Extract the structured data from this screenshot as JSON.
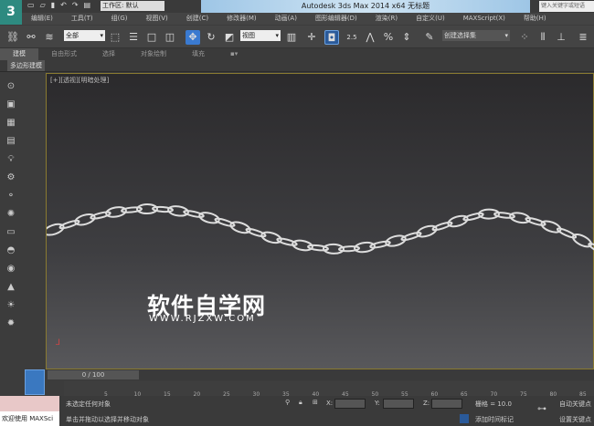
{
  "title_bar": {
    "logo": "3",
    "workspace": "工作区: 默认",
    "title": "Autodesk 3ds Max  2014 x64    无标题",
    "search_placeholder": "键入关键字或短语"
  },
  "menu": [
    "编辑(E)",
    "工具(T)",
    "组(G)",
    "视图(V)",
    "创建(C)",
    "修改器(M)",
    "动画(A)",
    "图形编辑器(D)",
    "渲染(R)",
    "自定义(U)",
    "MAXScript(X)",
    "帮助(H)"
  ],
  "toolbar": {
    "filter": "全部",
    "coord_system": "视图",
    "snap_angle": "2.5",
    "selection_set": "创建选择集"
  },
  "ribbon": {
    "tabs": [
      "建模",
      "自由形式",
      "选择",
      "对象绘制",
      "填充"
    ],
    "active": "建模",
    "subtab": "多边形建模"
  },
  "viewport": {
    "label": "[+][透视][明暗处理]"
  },
  "watermark": {
    "line1": "软件自学网",
    "line2": "WWW.RJZXW.COM"
  },
  "timeline": {
    "slider": "0 / 100",
    "ticks": [
      "5",
      "10",
      "15",
      "20",
      "25",
      "30",
      "35",
      "40",
      "45",
      "50",
      "55",
      "60",
      "65",
      "70",
      "75",
      "80",
      "85"
    ]
  },
  "status": {
    "welcome": "欢迎使用 MAXSci",
    "selection": "未选定任何对象",
    "prompt": "单击并拖动以选择并移动对象",
    "x_label": "X:",
    "y_label": "Y:",
    "z_label": "Z:",
    "grid": "栅格 = 10.0",
    "add_time_tag": "添加时间标记",
    "auto_key": "自动关键点",
    "set_key": "设置关键点"
  }
}
